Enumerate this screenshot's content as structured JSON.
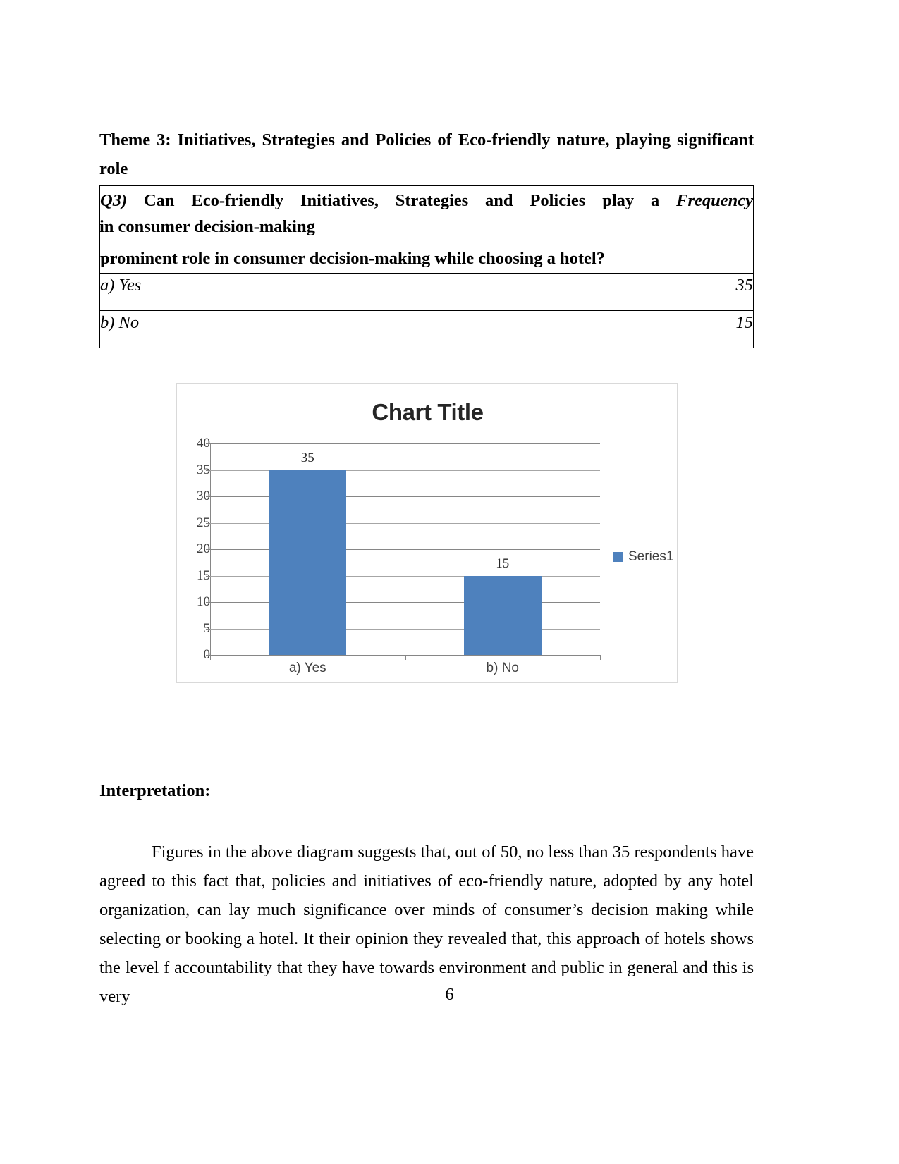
{
  "document": {
    "theme_heading": "Theme 3: Initiatives, Strategies and Policies of Eco-friendly nature, playing significant role in consumer decision-making",
    "theme_heading_line1": "Theme 3: Initiatives, Strategies and Policies of Eco-friendly nature, playing significant role",
    "theme_heading_line2": "in consumer decision-making",
    "page_number": "6"
  },
  "table": {
    "question_label": "Q3)",
    "question_line1": "Can Eco-friendly Initiatives, Strategies and Policies play a",
    "question_line2": "prominent role in consumer decision-making while choosing a hotel?",
    "frequency_header": "Frequency",
    "rows": [
      {
        "option": "a) Yes",
        "frequency": "35"
      },
      {
        "option": "b) No",
        "frequency": "15"
      }
    ]
  },
  "chart_data": {
    "type": "bar",
    "title": "Chart Title",
    "categories": [
      "a) Yes",
      "b) No"
    ],
    "values": [
      35,
      15
    ],
    "data_labels": [
      "35",
      "15"
    ],
    "series": [
      {
        "name": "Series1",
        "values": [
          35,
          15
        ]
      }
    ],
    "legend_entries": [
      "Series1"
    ],
    "legend_position": "right",
    "xlabel": "",
    "ylabel": "",
    "ylim": [
      0,
      40
    ],
    "ytick_step": 5,
    "ytick_labels": [
      "40",
      "35",
      "30",
      "25",
      "20",
      "15",
      "10",
      "5",
      "0"
    ],
    "grid": true,
    "series_color": "#4E81BD",
    "gridline_color": "#868686",
    "plot_background": "#FFFFFF",
    "border_color": "#D9D9D9"
  },
  "interpretation": {
    "heading": "Interpretation:",
    "body": "Figures in the above diagram suggests that,  out of 50, no less than 35 respondents have agreed to this fact that, policies and initiatives of eco-friendly nature, adopted by any hotel organization, can lay much significance over minds of consumer’s decision making while selecting or booking a hotel. It their opinion they revealed that, this approach of hotels shows the level f accountability that they have towards environment and public in general and this is very"
  }
}
